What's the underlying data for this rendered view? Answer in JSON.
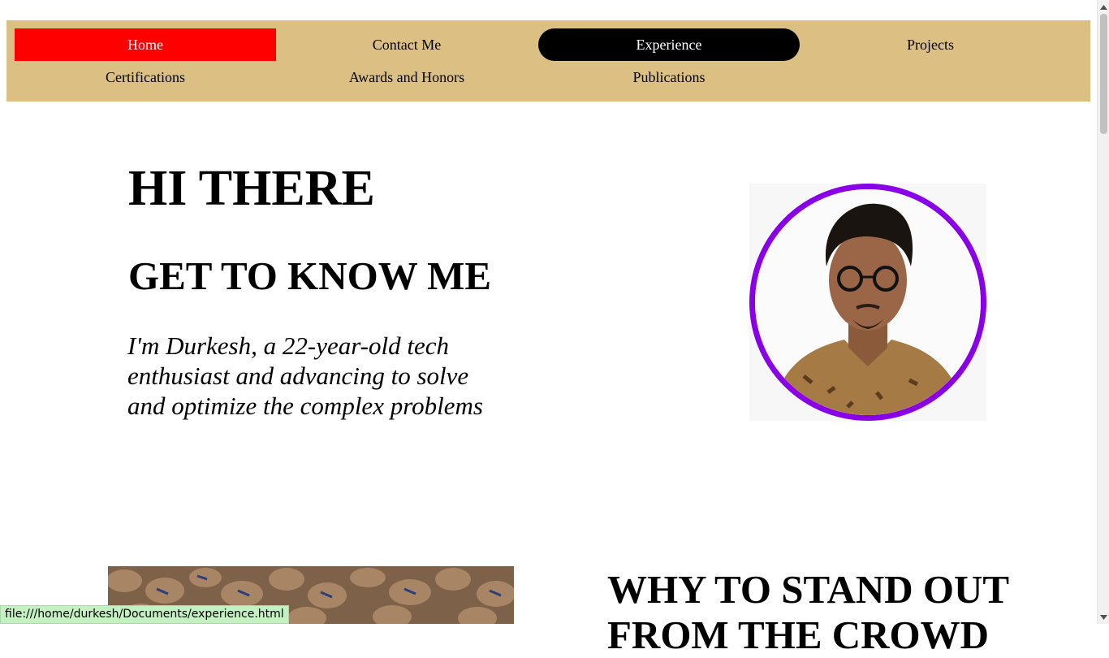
{
  "nav": {
    "items": [
      {
        "label": "Home"
      },
      {
        "label": "Contact Me"
      },
      {
        "label": "Experience"
      },
      {
        "label": "Projects"
      },
      {
        "label": "Certifications"
      },
      {
        "label": "Awards and Honors"
      },
      {
        "label": "Publications"
      }
    ]
  },
  "hero": {
    "title": "HI THERE",
    "subtitle": "GET TO KNOW ME",
    "description": "I'm Durkesh, a 22-year-old tech enthusiast and advancing to solve and optimize the complex problems"
  },
  "section2": {
    "title": "WHY TO STAND OUT FROM THE CROWD"
  },
  "status": {
    "url": "file:///home/durkesh/Documents/experience.html"
  },
  "colors": {
    "nav_bg": "#dcbf83",
    "home_active": "#ff0000",
    "experience_hover": "#000000",
    "profile_ring": "#8a00e6",
    "status_bg": "#c4f0c2"
  }
}
